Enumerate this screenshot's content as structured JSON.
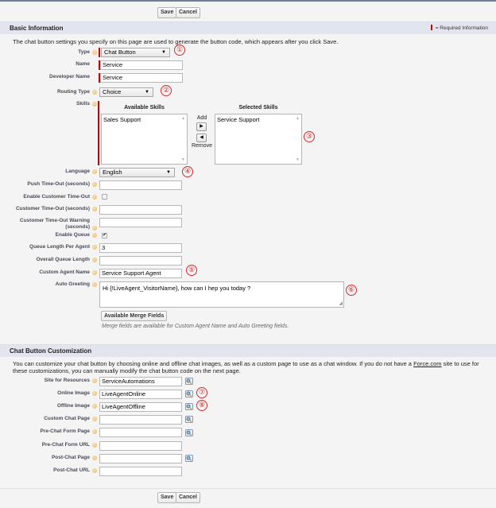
{
  "buttons": {
    "save": "Save",
    "cancel": "Cancel"
  },
  "basic_info": {
    "title": "Basic Information",
    "required_legend": "= Required Information",
    "description": "The chat button settings you specify on this page are used to generate the button code, which appears after you click Save.",
    "fields": {
      "type": {
        "label": "Type",
        "value": "Chat Button"
      },
      "name": {
        "label": "Name",
        "value": "Service"
      },
      "developer_name": {
        "label": "Developer Name",
        "value": "Service"
      },
      "routing_type": {
        "label": "Routing Type",
        "value": "Choice"
      },
      "skills": {
        "label": "Skills",
        "available_header": "Available Skills",
        "selected_header": "Selected Skills",
        "available": [
          "Sales Support"
        ],
        "selected": [
          "Service Support"
        ],
        "add_label": "Add",
        "remove_label": "Remove"
      },
      "language": {
        "label": "Language",
        "value": "English"
      },
      "push_timeout": {
        "label": "Push Time-Out (seconds)",
        "value": ""
      },
      "enable_customer_timeout": {
        "label": "Enable Customer Time-Out",
        "checked": false
      },
      "customer_timeout": {
        "label": "Customer Time-Out (seconds)",
        "value": ""
      },
      "customer_timeout_warning": {
        "label": "Customer Time-Out Warning (seconds)",
        "value": ""
      },
      "enable_queue": {
        "label": "Enable Queue",
        "checked": true,
        "check_glyph": "✔"
      },
      "queue_length_per_agent": {
        "label": "Queue Length Per Agent",
        "value": "3"
      },
      "overall_queue_length": {
        "label": "Overall Queue Length",
        "value": ""
      },
      "custom_agent_name": {
        "label": "Custom Agent Name",
        "value": "Service Support  Agent"
      },
      "auto_greeting": {
        "label": "Auto Greeting",
        "value": "Hi {!LiveAgent_VisitorName}, how can I hep you today ?"
      }
    },
    "merge_fields_button": "Available Merge Fields",
    "merge_fields_hint": "Merge fields are available for Custom Agent Name and Auto Greeting fields."
  },
  "customization": {
    "title": "Chat Button Customization",
    "description_part1": "You can customize your chat button by choosing online and offline chat images, as well as a custom page to use as a chat window. If you do not have a ",
    "description_link": "Force.com",
    "description_part2": " site to use for these customizations, you can manually modify the chat button code on the next page.",
    "fields": {
      "site_for_resources": {
        "label": "Site for Resources",
        "value": "ServiceAutomations"
      },
      "online_image": {
        "label": "Online Image",
        "value": "LiveAgentOnline"
      },
      "offline_image": {
        "label": "Offline Image",
        "value": "LiveAgentOffline"
      },
      "custom_chat_page": {
        "label": "Custom Chat Page",
        "value": ""
      },
      "pre_chat_form_page": {
        "label": "Pre-Chat Form Page",
        "value": ""
      },
      "pre_chat_form_url": {
        "label": "Pre-Chat Form URL",
        "value": ""
      },
      "post_chat_page": {
        "label": "Post-Chat Page",
        "value": ""
      },
      "post_chat_url": {
        "label": "Post-Chat URL",
        "value": ""
      }
    }
  },
  "callouts": [
    "①",
    "②",
    "③",
    "④",
    "⑤",
    "⑥",
    "⑦",
    "⑧"
  ],
  "icons": {
    "dropdown": "▼",
    "add_arrow": "▶",
    "remove_arrow": "◀",
    "scroll_up": "▲",
    "scroll_down": "▼",
    "resize_grip": "◢"
  },
  "colors": {
    "required": "#cc0000",
    "callout": "#d42a2a",
    "section_header": "#e3e5ee",
    "page_bg": "#f4f4f4"
  }
}
